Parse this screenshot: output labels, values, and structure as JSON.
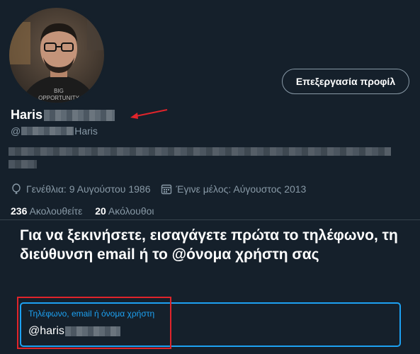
{
  "profile": {
    "display_name": "Haris",
    "handle_prefix": "@",
    "handle_suffix": "Haris",
    "edit_button": "Επεξεργασία προφίλ",
    "birthday": "Γενέθλια: 9 Αυγούστου 1986",
    "joined": "Έγινε μέλος: Αύγουστος 2013",
    "following_count": "236",
    "following_label": "Ακολουθείτε",
    "followers_count": "20",
    "followers_label": "Ακόλουθοι"
  },
  "dialog": {
    "title": "Για να ξεκινήσετε, εισαγάγετε πρώτα το τηλέφωνο, τη διεύθυνση email ή το @όνομα χρήστη σας",
    "field_label": "Τηλέφωνο, email ή όνομα χρήστη",
    "field_value": "@haris"
  },
  "colors": {
    "background": "#15202b",
    "accent": "#1da1f2",
    "secondary_text": "#8899a6",
    "annotation": "#e0242b"
  }
}
